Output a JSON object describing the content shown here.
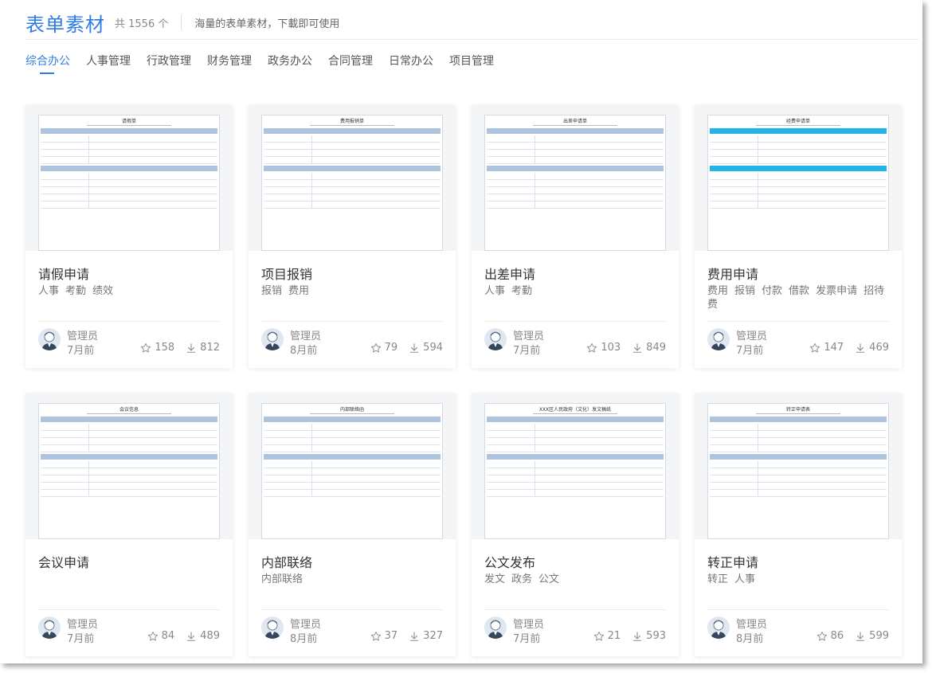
{
  "header": {
    "title": "表单素材",
    "count": "共 1556 个",
    "desc": "海量的表单素材，下載即可使用"
  },
  "tabs": [
    "综合办公",
    "人事管理",
    "行政管理",
    "财务管理",
    "政务办公",
    "合同管理",
    "日常办公",
    "项目管理"
  ],
  "cards": [
    {
      "name": "请假申请",
      "tags": [
        "人事",
        "考勤",
        "绩效"
      ],
      "author": "管理员",
      "time": "7月前",
      "stars": "158",
      "downloads": "812",
      "thumb_title": "请假单"
    },
    {
      "name": "项目报销",
      "tags": [
        "报销",
        "费用"
      ],
      "author": "管理员",
      "time": "8月前",
      "stars": "79",
      "downloads": "594",
      "thumb_title": "费用报销单"
    },
    {
      "name": "出差申请",
      "tags": [
        "人事",
        "考勤"
      ],
      "author": "管理员",
      "time": "7月前",
      "stars": "103",
      "downloads": "849",
      "thumb_title": "出差申请单"
    },
    {
      "name": "费用申请",
      "tags": [
        "费用",
        "报销",
        "付款",
        "借款",
        "发票申请",
        "招待费"
      ],
      "author": "管理员",
      "time": "7月前",
      "stars": "147",
      "downloads": "469",
      "thumb_title": "经费申请单"
    },
    {
      "name": "会议申请",
      "tags": [],
      "author": "管理员",
      "time": "7月前",
      "stars": "84",
      "downloads": "489",
      "thumb_title": "会议信息"
    },
    {
      "name": "内部联络",
      "tags": [
        "内部联络"
      ],
      "author": "管理员",
      "time": "8月前",
      "stars": "37",
      "downloads": "327",
      "thumb_title": "内部联络函"
    },
    {
      "name": "公文发布",
      "tags": [
        "发文",
        "政务",
        "公文"
      ],
      "author": "管理员",
      "time": "7月前",
      "stars": "21",
      "downloads": "593",
      "thumb_title": "XXX区人民政府（文化）发文稿纸"
    },
    {
      "name": "转正申请",
      "tags": [
        "转正",
        "人事"
      ],
      "author": "管理员",
      "time": "8月前",
      "stars": "86",
      "downloads": "599",
      "thumb_title": "转正申请表"
    }
  ],
  "colors": {
    "accent": "#2f7be5"
  }
}
